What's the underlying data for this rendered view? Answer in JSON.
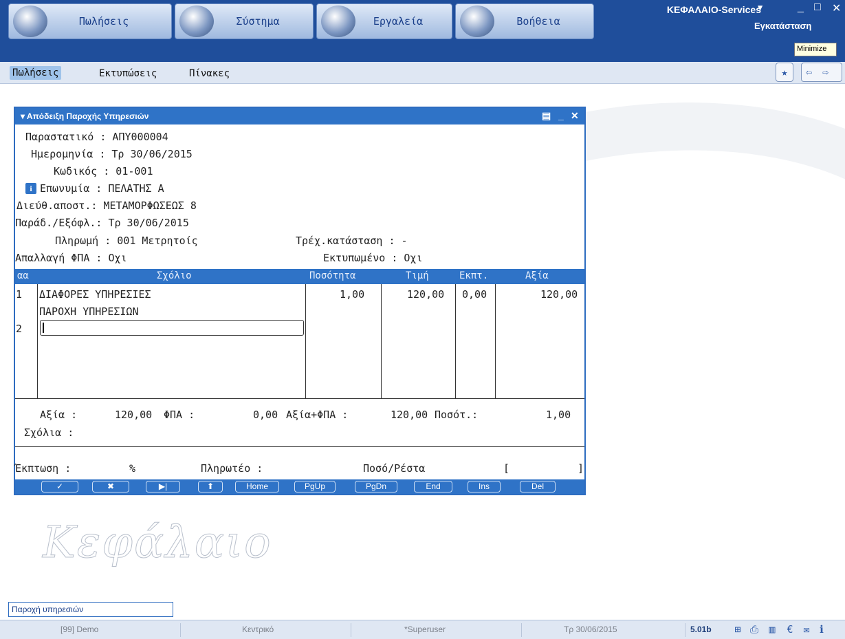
{
  "topbar": {
    "buttons": [
      {
        "label": "Πωλήσεις",
        "icon": "sales-icon"
      },
      {
        "label": "Σύστημα",
        "icon": "system-icon"
      },
      {
        "label": "Εργαλεία",
        "icon": "calculator-icon"
      },
      {
        "label": "Βοήθεια",
        "icon": "help-icon"
      }
    ],
    "brand": "ΚΕΦΑΛΑΙΟ-Services",
    "install_label": "Εγκατάσταση",
    "tooltip": "Minimize"
  },
  "menubar": {
    "items": [
      "Πωλήσεις",
      "Εκτυπώσεις",
      "Πίνακες"
    ]
  },
  "document": {
    "title": "Απόδειξη Παροχής Υπηρεσιών",
    "fields": {
      "parastatiko": "Παραστατικό : ΑΠΥ000004",
      "hmeromhnia": "Ημερομηνία : Τρ 30/06/2015",
      "kodikos": "Κωδικός : 01-001",
      "eponymia": "Επωνυμία : ΠΕΛΑΤΗΣ Α",
      "dieuth": "Διεύθ.αποστ.: ΜΕΤΑΜΟΡΦΩΣΕΩΣ 8",
      "parad": "Παράδ./Εξόφλ.: Τρ 30/06/2015",
      "plhrwmh": "Πληρωμή : 001 Μετρητοίς",
      "trex": "Τρέχ.κατάσταση : -",
      "apallagh": "Απαλλαγή ΦΠΑ : Οχι",
      "ektypwmeno": "Εκτυπωμένο : Οχι"
    },
    "grid": {
      "headers": [
        "αα",
        "Σχόλιο",
        "Ποσότητα",
        "Τιμή",
        "Εκπτ.",
        "Αξία"
      ],
      "rows": [
        {
          "aa": "1",
          "line1": "ΔΙΑΦΟΡΕΣ ΥΠΗΡΕΣΙΕΣ",
          "line2": "ΠΑΡΟΧΗ ΥΠΗΡΕΣΙΩΝ",
          "qty": "1,00",
          "price": "120,00",
          "disc": "0,00",
          "value": "120,00"
        },
        {
          "aa": "2",
          "line1": "",
          "line2": "",
          "qty": "",
          "price": "",
          "disc": "",
          "value": ""
        }
      ]
    },
    "totals": {
      "axia_label": "Αξία :",
      "axia_value": "120,00",
      "fpa_label": "ΦΠΑ :",
      "fpa_value": "0,00",
      "axia_fpa_label": "Αξία+ΦΠΑ :",
      "axia_fpa_value": "120,00",
      "posot_label": "Ποσότ.:",
      "posot_value": "1,00",
      "sxolia_label": "Σχόλια :"
    },
    "payment": {
      "ekptwsh_label": "Έκπτωση :",
      "percent": "%",
      "plhrwteo_label": "Πληρωτέο :",
      "poso_resta_label": "Ποσό/Ρέστα",
      "bracket_open": "[",
      "bracket_close": "]"
    },
    "keys": [
      "✓",
      "✖",
      "▶|",
      "⬆",
      "Home",
      "PgUp",
      "PgDn",
      "End",
      "Ins",
      "Del"
    ]
  },
  "watermark": "Κεφάλαιο",
  "status": {
    "input_value": "Παροχή υπηρεσιών",
    "segments": [
      "[99] Demo",
      "Κεντρικό",
      "*Superuser",
      "Τρ 30/06/2015"
    ],
    "version": "5.01b",
    "icons": [
      "network-icon",
      "printer-icon",
      "barcode-icon",
      "euro-icon",
      "mail-icon",
      "info-icon"
    ]
  }
}
